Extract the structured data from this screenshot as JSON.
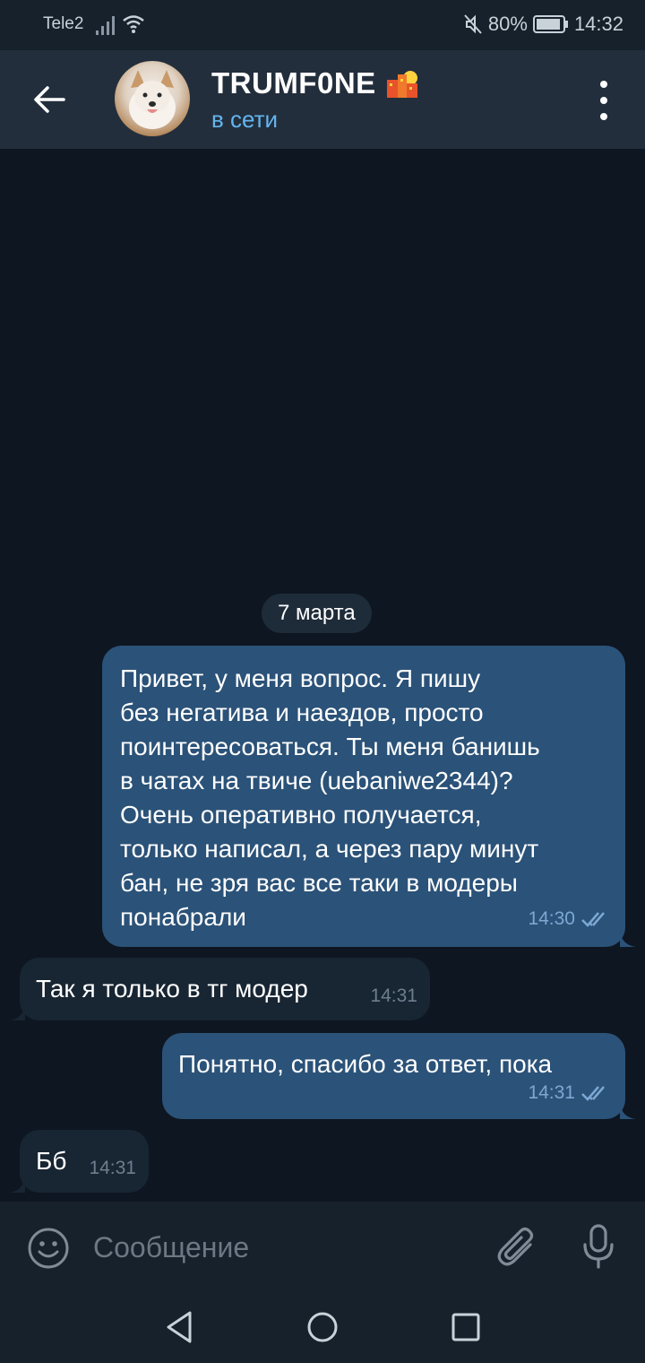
{
  "status_bar": {
    "carrier": "Tele2",
    "battery": "80%",
    "time": "14:32"
  },
  "header": {
    "title": "TRUMF0NE",
    "status": "в сети"
  },
  "chat": {
    "date_label": "7 марта",
    "messages": [
      {
        "direction": "out",
        "text": "Привет, у меня вопрос. Я пишу\nбез негатива и наездов, просто\nпоинтересоваться. Ты меня банишь\nв чатах на твиче (uebaniwe2344)?\nОчень оперативно получается,\nтолько написал, а через пару минут\nбан, не зря вас все таки в модеры\nпонабрали",
        "time": "14:30",
        "read": true
      },
      {
        "direction": "in",
        "text": "Так я только в тг модер",
        "time": "14:31"
      },
      {
        "direction": "out",
        "text": "Понятно, спасибо за ответ, пока",
        "time": "14:31",
        "read": true
      },
      {
        "direction": "in",
        "text": "Бб",
        "time": "14:31"
      }
    ]
  },
  "composer": {
    "placeholder": "Сообщение"
  },
  "colors": {
    "header_bg": "#232e3c",
    "chat_bg": "#0e1621",
    "outgoing_bubble": "#2b5278",
    "incoming_bubble": "#182533",
    "accent": "#64b5ef"
  },
  "icons": {
    "back": "arrow-left-icon",
    "menu": "more-vertical-icon",
    "emoji": "smile-icon",
    "attach": "paperclip-icon",
    "mic": "microphone-icon",
    "read_receipt": "double-check-icon"
  }
}
